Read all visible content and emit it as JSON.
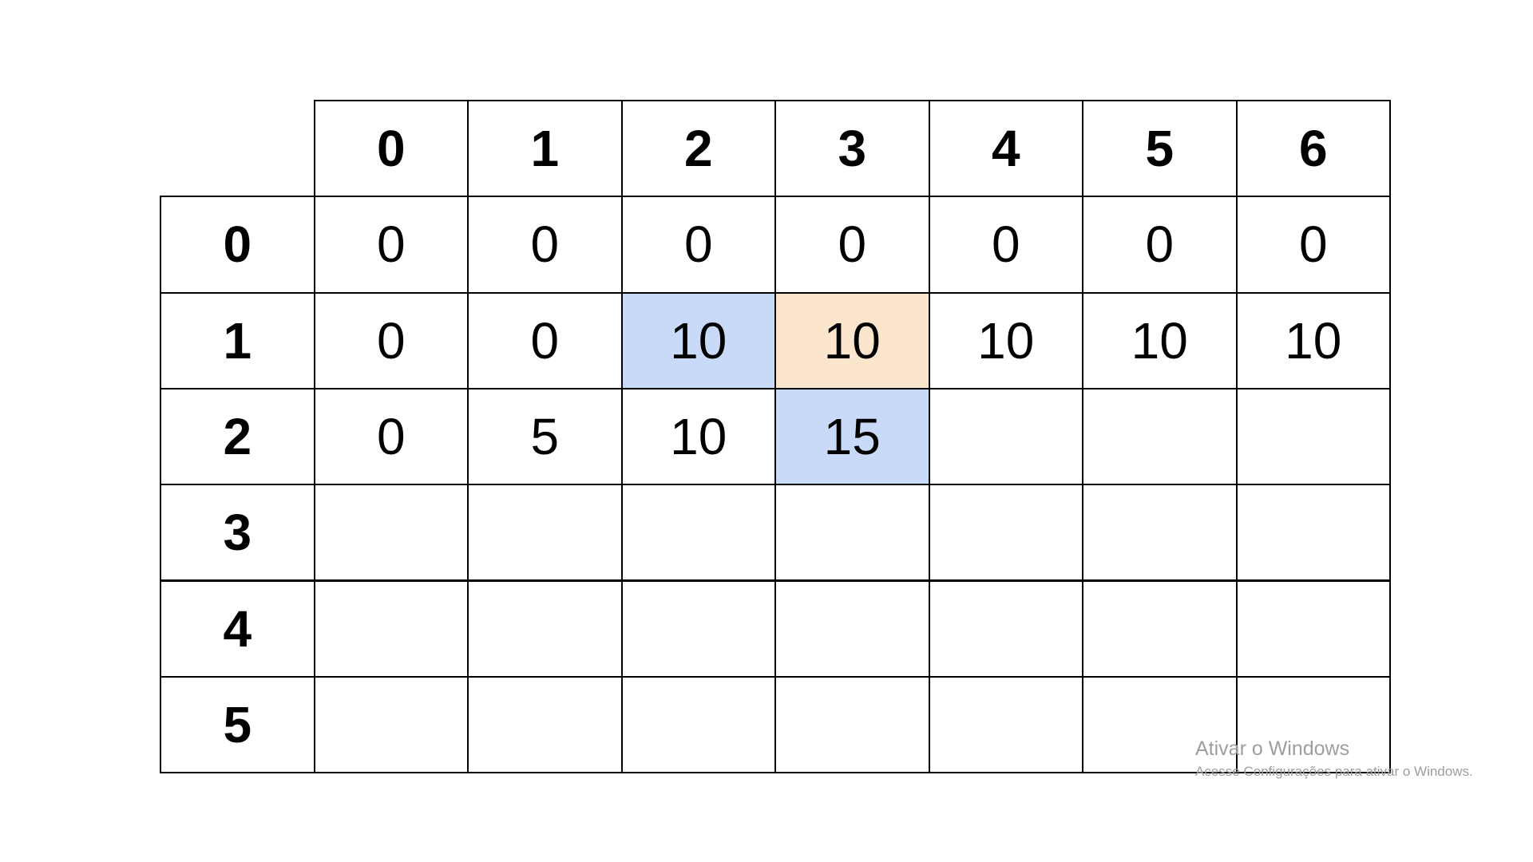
{
  "table": {
    "column_headers": [
      "0",
      "1",
      "2",
      "3",
      "4",
      "5",
      "6"
    ],
    "row_headers": [
      "0",
      "1",
      "2",
      "3",
      "4",
      "5"
    ],
    "rows": [
      [
        "0",
        "0",
        "0",
        "0",
        "0",
        "0",
        "0"
      ],
      [
        "0",
        "0",
        "10",
        "10",
        "10",
        "10",
        "10"
      ],
      [
        "0",
        "5",
        "10",
        "15",
        "",
        "",
        ""
      ],
      [
        "",
        "",
        "",
        "",
        "",
        "",
        ""
      ],
      [
        "",
        "",
        "",
        "",
        "",
        "",
        ""
      ],
      [
        "",
        "",
        "",
        "",
        "",
        "",
        ""
      ]
    ],
    "highlights": [
      {
        "row": 1,
        "col": 2,
        "color": "#c9daf8"
      },
      {
        "row": 1,
        "col": 3,
        "color": "#fce5cd"
      },
      {
        "row": 2,
        "col": 3,
        "color": "#c9daf8"
      }
    ]
  },
  "watermark": {
    "title": "Ativar o Windows",
    "subtitle": "Acesse Configurações para ativar o Windows."
  }
}
